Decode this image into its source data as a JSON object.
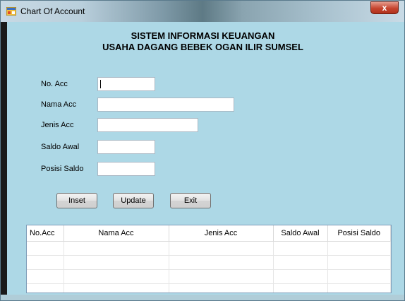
{
  "window": {
    "title": "Chart Of Account",
    "close_label": "x"
  },
  "header": {
    "line1": "SISTEM INFORMASI KEUANGAN",
    "line2": "USAHA DAGANG BEBEK OGAN ILIR SUMSEL"
  },
  "form": {
    "no_acc": {
      "label": "No. Acc",
      "value": ""
    },
    "nama_acc": {
      "label": "Nama Acc",
      "value": ""
    },
    "jenis_acc": {
      "label": "Jenis Acc",
      "value": ""
    },
    "saldo_awal": {
      "label": "Saldo Awal",
      "value": ""
    },
    "posisi_saldo": {
      "label": "Posisi Saldo",
      "value": ""
    }
  },
  "buttons": {
    "inset": "Inset",
    "update": "Update",
    "exit": "Exit"
  },
  "grid": {
    "columns": [
      "No.Acc",
      "Nama Acc",
      "Jenis Acc",
      "Saldo Awal",
      "Posisi Saldo"
    ],
    "rows": []
  }
}
